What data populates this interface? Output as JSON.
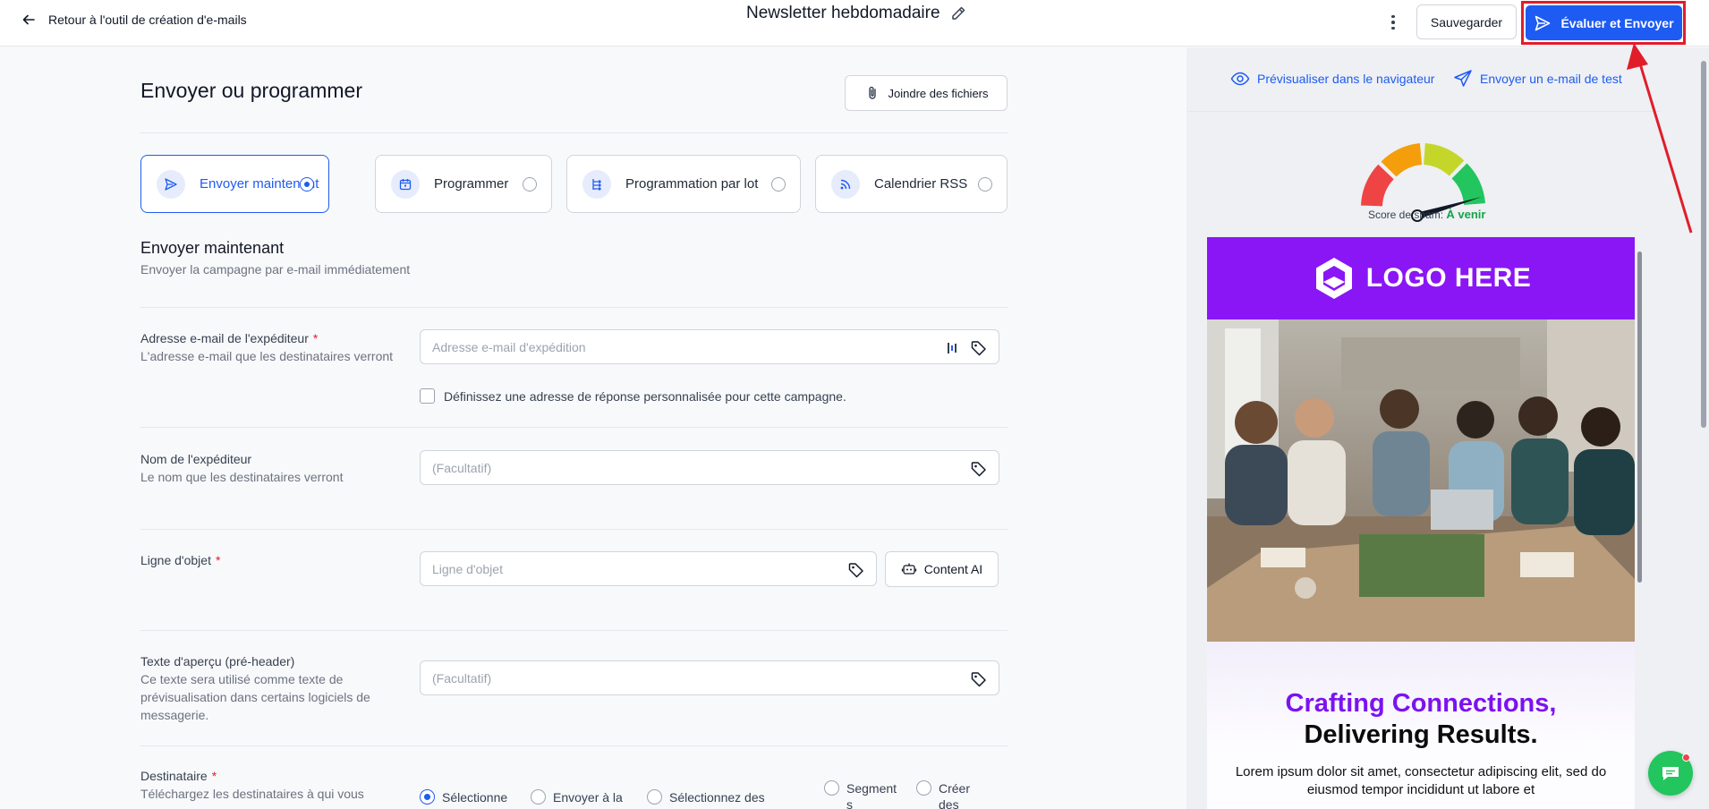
{
  "topbar": {
    "back_label": "Retour à l'outil de création d'e-mails",
    "doc_title": "Newsletter hebdomadaire",
    "save_label": "Sauvegarder",
    "send_label": "Évaluer et Envoyer"
  },
  "main": {
    "title": "Envoyer ou programmer",
    "attach_label": "Joindre des fichiers",
    "modes": [
      {
        "label": "Envoyer maintenant",
        "icon": "send-icon",
        "selected": true
      },
      {
        "label": "Programmer",
        "icon": "calendar-icon",
        "selected": false
      },
      {
        "label": "Programmation par lot",
        "icon": "batch-schedule-icon",
        "selected": false
      },
      {
        "label": "Calendrier RSS",
        "icon": "rss-icon",
        "selected": false
      }
    ],
    "section_title": "Envoyer maintenant",
    "section_sub": "Envoyer la campagne par e-mail immédiatement",
    "sender_email": {
      "label": "Adresse e-mail de l'expéditeur",
      "required_mark": "*",
      "help": "L'adresse e-mail que les destinataires verront",
      "placeholder": "Adresse e-mail d'expédition",
      "value": ""
    },
    "reply_checkbox": {
      "label": "Définissez une adresse de réponse personnalisée pour cette campagne.",
      "checked": false
    },
    "sender_name": {
      "label": "Nom de l'expéditeur",
      "help": "Le nom que les destinataires verront",
      "placeholder": "(Facultatif)",
      "value": ""
    },
    "subject": {
      "label": "Ligne d'objet",
      "required_mark": "*",
      "placeholder": "Ligne d'objet",
      "value": "",
      "ai_label": "Content AI"
    },
    "preheader": {
      "label": "Texte d'aperçu (pré-header)",
      "help": "Ce texte sera utilisé comme texte de prévisualisation dans certains logiciels de messagerie.",
      "placeholder": "(Facultatif)",
      "value": ""
    },
    "recipient": {
      "label": "Destinataire",
      "required_mark": "*",
      "help": "Téléchargez les destinataires à qui vous",
      "options": [
        {
          "label": "Sélectionne",
          "selected": true
        },
        {
          "label": "Envoyer à la",
          "selected": false
        },
        {
          "label": "Sélectionnez des",
          "selected": false
        },
        {
          "label": "Segment s",
          "selected": false
        },
        {
          "label": "Créer des",
          "selected": false
        }
      ]
    }
  },
  "preview": {
    "browser_preview_label": "Prévisualiser dans le navigateur",
    "test_email_label": "Envoyer un e-mail de test",
    "spam_score_label": "Score de spam:",
    "spam_score_value": "À venir",
    "spam_score_color": "#16a34a",
    "email": {
      "logo_text": "LOGO HERE",
      "header_color": "#8a16f5",
      "headline_1": "Crafting Connections,",
      "headline_2": "Delivering Results.",
      "body": "Lorem ipsum dolor sit amet, consectetur adipiscing elit, sed do eiusmod tempor incididunt ut labore et"
    }
  },
  "colors": {
    "accent": "#1e5bf2",
    "highlight": "#e11d2a"
  }
}
